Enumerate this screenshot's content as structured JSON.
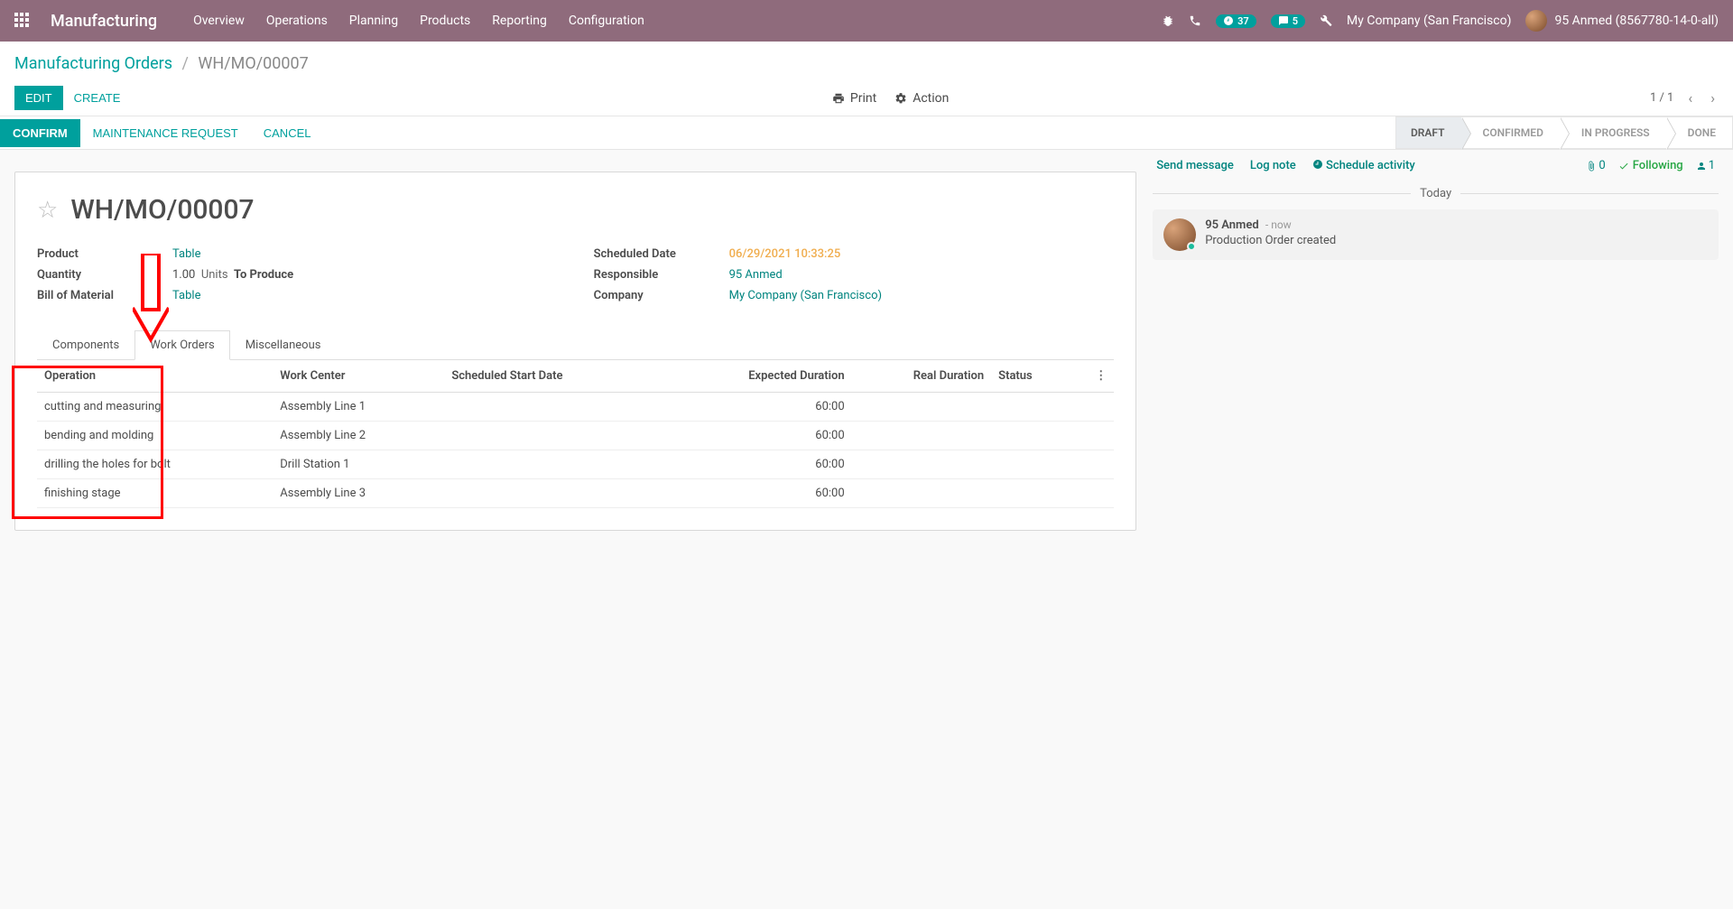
{
  "nav": {
    "brand": "Manufacturing",
    "menu": [
      "Overview",
      "Operations",
      "Planning",
      "Products",
      "Reporting",
      "Configuration"
    ],
    "activity_badge": "37",
    "discuss_badge": "5",
    "company": "My Company (San Francisco)",
    "user": "95 Anmed (8567780-14-0-all)"
  },
  "breadcrumb": {
    "root": "Manufacturing Orders",
    "current": "WH/MO/00007"
  },
  "cp": {
    "edit": "EDIT",
    "create": "CREATE",
    "print": "Print",
    "action": "Action",
    "pager": "1 / 1"
  },
  "status": {
    "confirm": "CONFIRM",
    "maintenance": "MAINTENANCE REQUEST",
    "cancel": "CANCEL",
    "stages": [
      "DRAFT",
      "CONFIRMED",
      "IN PROGRESS",
      "DONE"
    ],
    "active_stage": "DRAFT"
  },
  "form": {
    "title": "WH/MO/00007",
    "left": {
      "product_label": "Product",
      "product_value": "Table",
      "quantity_label": "Quantity",
      "quantity_value": "1.00",
      "quantity_unit": "Units",
      "quantity_status": "To Produce",
      "bom_label": "Bill of Material",
      "bom_value": "Table"
    },
    "right": {
      "scheduled_label": "Scheduled Date",
      "scheduled_value": "06/29/2021 10:33:25",
      "responsible_label": "Responsible",
      "responsible_value": "95 Anmed",
      "company_label": "Company",
      "company_value": "My Company (San Francisco)"
    },
    "tabs": {
      "components": "Components",
      "workorders": "Work Orders",
      "misc": "Miscellaneous"
    },
    "table": {
      "headers": {
        "operation": "Operation",
        "workcenter": "Work Center",
        "startdate": "Scheduled Start Date",
        "expdur": "Expected Duration",
        "realdur": "Real Duration",
        "status": "Status"
      },
      "rows": [
        {
          "operation": "cutting and measuring",
          "workcenter": "Assembly Line 1",
          "startdate": "",
          "expdur": "60:00",
          "realdur": "",
          "status": ""
        },
        {
          "operation": "bending and molding",
          "workcenter": "Assembly Line 2",
          "startdate": "",
          "expdur": "60:00",
          "realdur": "",
          "status": ""
        },
        {
          "operation": "drilling the holes for bolt",
          "workcenter": "Drill Station 1",
          "startdate": "",
          "expdur": "60:00",
          "realdur": "",
          "status": ""
        },
        {
          "operation": "finishing stage",
          "workcenter": "Assembly Line 3",
          "startdate": "",
          "expdur": "60:00",
          "realdur": "",
          "status": ""
        }
      ]
    }
  },
  "chatter": {
    "send": "Send message",
    "lognote": "Log note",
    "schedule": "Schedule activity",
    "attach_count": "0",
    "following": "Following",
    "follower_count": "1",
    "today": "Today",
    "msg": {
      "author": "95 Anmed",
      "time": "now",
      "text": "Production Order created"
    }
  }
}
